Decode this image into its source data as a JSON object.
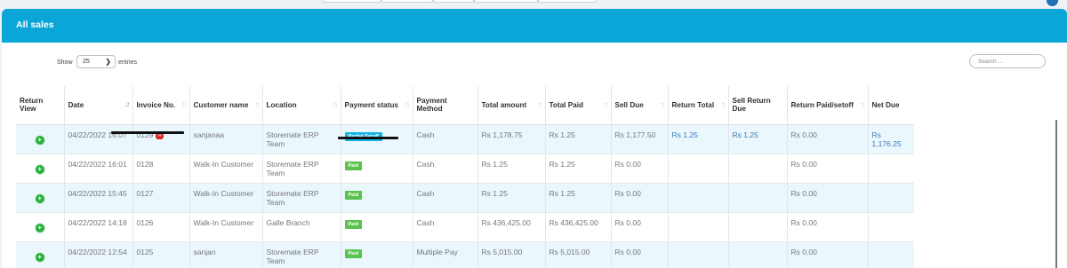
{
  "card": {
    "title": "All sales"
  },
  "controls": {
    "show_label": "Show",
    "entries_value": "25",
    "entries_label": "entries",
    "search_placeholder": "Search ..."
  },
  "table": {
    "columns": [
      "Return View",
      "Date",
      "Invoice No.",
      "Customer name",
      "Location",
      "Payment status",
      "Payment Method",
      "Total amount",
      "Total Paid",
      "Sell Due",
      "Return Total",
      "Sell Return Due",
      "Return Paid/setoff",
      "Net Due"
    ],
    "rows": [
      {
        "date": "04/22/2022 16:07",
        "invoice": "0129",
        "return_badge": "R",
        "customer": "sanjanaa",
        "location": "Storemate ERP Team",
        "status": "Partial-Setoff",
        "status_type": "partial",
        "method": "Cash",
        "total": "Rs 1,178.75",
        "paid": "Rs 1.25",
        "sell_due": "Rs 1,177.50",
        "return_total": "Rs 1.25",
        "sell_return_due": "Rs 1.25",
        "return_paid": "Rs 0.00",
        "net_due": "Rs 1,176.25"
      },
      {
        "date": "04/22/2022 16:01",
        "invoice": "0128",
        "return_badge": "",
        "customer": "Walk-In Customer",
        "location": "Storemate ERP Team",
        "status": "Paid",
        "status_type": "paid",
        "method": "Cash",
        "total": "Rs 1.25",
        "paid": "Rs 1.25",
        "sell_due": "Rs 0.00",
        "return_total": "",
        "sell_return_due": "",
        "return_paid": "Rs 0.00",
        "net_due": ""
      },
      {
        "date": "04/22/2022 15:45",
        "invoice": "0127",
        "return_badge": "",
        "customer": "Walk-In Customer",
        "location": "Storemate ERP Team",
        "status": "Paid",
        "status_type": "paid",
        "method": "Cash",
        "total": "Rs 1.25",
        "paid": "Rs 1.25",
        "sell_due": "Rs 0.00",
        "return_total": "",
        "sell_return_due": "",
        "return_paid": "Rs 0.00",
        "net_due": ""
      },
      {
        "date": "04/22/2022 14:18",
        "invoice": "0126",
        "return_badge": "",
        "customer": "Walk-In Customer",
        "location": "Galle Branch",
        "status": "Paid",
        "status_type": "paid",
        "method": "Cash",
        "total": "Rs 436,425.00",
        "paid": "Rs 436,425.00",
        "sell_due": "Rs 0.00",
        "return_total": "",
        "sell_return_due": "",
        "return_paid": "Rs 0.00",
        "net_due": ""
      },
      {
        "date": "04/22/2022 12:54",
        "invoice": "0125",
        "return_badge": "",
        "customer": "sanjan",
        "location": "Storemate ERP Team",
        "status": "Paid",
        "status_type": "paid",
        "method": "Multiple Pay",
        "total": "Rs 5,015.00",
        "paid": "Rs 5,015.00",
        "sell_due": "Rs 0.00",
        "return_total": "",
        "sell_return_due": "",
        "return_paid": "Rs 0.00",
        "net_due": ""
      }
    ]
  },
  "icons": {
    "expand": "plus-circle-icon",
    "sort": "sort-arrows-icon",
    "dropdown": "chevron-down-icon"
  },
  "colors": {
    "header": "#0aa6d8",
    "row_stripe": "#eaf7fc",
    "paid": "#5cc24e",
    "partial": "#12b5e8",
    "expand": "#27ae3c",
    "return_badge": "#d9231f"
  }
}
